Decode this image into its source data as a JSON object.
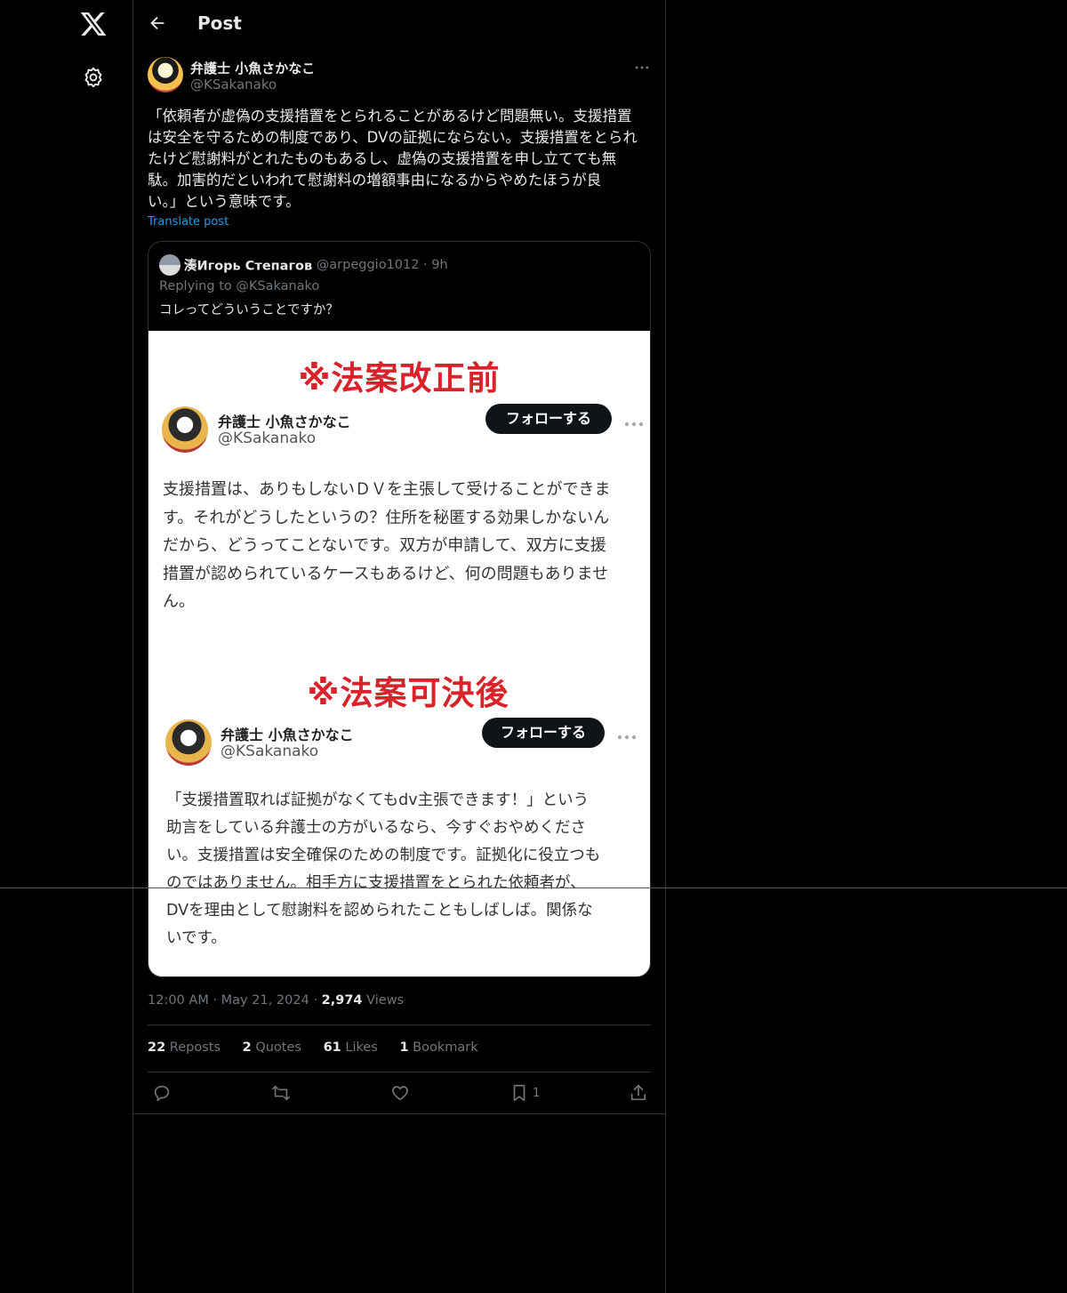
{
  "header": {
    "title": "Post"
  },
  "author": {
    "name": "弁護士 小魚さかなこ",
    "handle": "@KSakanako"
  },
  "tweet": {
    "text": "「依頼者が虚偽の支援措置をとられることがあるけど問題無い。支援措置\nは安全を守るための制度であり、DVの証拠にならない。支援措置をとられ\nたけど慰謝料がとれたものもあるし、虚偽の支援措置を申し立てても無\n駄。加害的だといわれて慰謝料の増額事由になるからやめたほうが良\nい。」という意味です。",
    "translate_label": "Translate post"
  },
  "quote": {
    "name": "湊Игорь Степагов",
    "handle": "@arpeggio1012",
    "age": "9h",
    "reply_line": "Replying to @KSakanako",
    "text": "コレってどういうことですか？",
    "image": {
      "section1": {
        "banner": "※法案改正前",
        "name": "弁護士 小魚さかなこ",
        "handle": "@KSakanako",
        "follow_label": "フォローする",
        "body": "支援措置は、ありもしないＤＶを主張して受けることができま\nす。それがどうしたというの？住所を秘匿する効果しかないん\nだから、どうってことないです。双方が申請して、双方に支援\n措置が認められているケースもあるけど、何の問題もありませ\nん。"
      },
      "section2": {
        "banner": "※法案可決後",
        "name": "弁護士 小魚さかなこ",
        "handle": "@KSakanako",
        "follow_label": "フォローする",
        "body": "「支援措置取れば証拠がなくてもdv主張できます！」という\n助言をしている弁護士の方がいるなら、今すぐおやめくださ\nい。支援措置は安全確保のための制度です。証拠化に役立つも\nのではありません。相手方に支援措置をとられた依頼者が、\nDVを理由として慰謝料を認められたこともしばしば。関係な\nいです。"
      }
    }
  },
  "meta": {
    "time": "12:00 AM",
    "date": "May 21, 2024",
    "views": "2,974",
    "views_label": "Views"
  },
  "stats": {
    "reposts": "22",
    "reposts_label": "Reposts",
    "quotes": "2",
    "quotes_label": "Quotes",
    "likes": "61",
    "likes_label": "Likes",
    "bookmarks": "1",
    "bookmarks_label": "Bookmark"
  },
  "actions": {
    "bookmark_count": "1"
  },
  "icons": [
    "x-logo-icon",
    "settings-icon",
    "back-arrow-icon",
    "more-icon",
    "reply-icon",
    "repost-icon",
    "like-icon",
    "bookmark-icon",
    "share-icon"
  ]
}
